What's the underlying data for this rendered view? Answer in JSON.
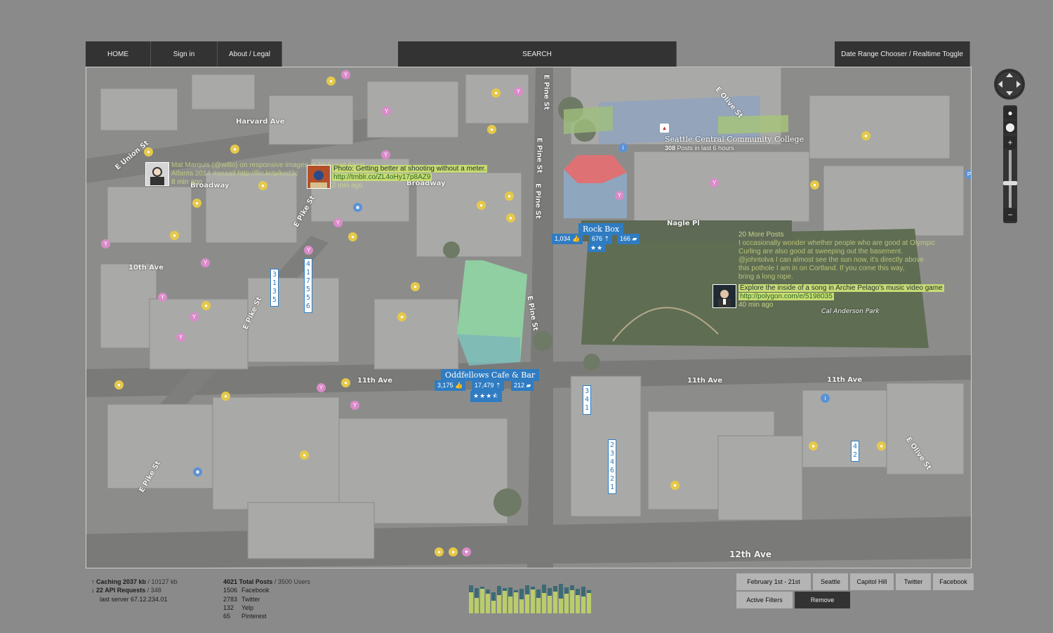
{
  "nav": {
    "home": "HOME",
    "signin": "Sign in",
    "about": "About / Legal",
    "search": "SEARCH",
    "date_toggle": "Date Range Chooser / Realtime Toggle"
  },
  "streets": {
    "harvard": "Harvard Ave",
    "union": "E Union St",
    "broadway_a": "Broadway",
    "broadway_b": "Broadway",
    "pike_a": "E Pike St",
    "pike_b": "E Pike St",
    "pike_c": "E Pike St",
    "tenth": "10th Ave",
    "eleventh_a": "11th Ave",
    "eleventh_b": "11th Ave",
    "eleventh_c": "11th Ave",
    "twelfth": "12th Ave",
    "pine_a": "E Pine St",
    "pine_b": "E Pine St",
    "pine_c": "E Pine St",
    "pine_d": "E Pine St",
    "olive_a": "E Olive St",
    "olive_b": "E Olive St",
    "nagle": "Nagle Pl",
    "park": "Cal Anderson Park"
  },
  "campus": {
    "name": "Seattle Central Community College",
    "count": "308",
    "suffix": " Posts in last 6 hours"
  },
  "venues": {
    "rockbox": {
      "name": "Rock Box",
      "likes": "1,034",
      "checkins": "676",
      "comments": "166",
      "stars": "★★"
    },
    "oddfellows": {
      "name": "Oddfellows Cafe & Bar",
      "likes": "3,175",
      "checkins": "17,479",
      "comments": "212",
      "stars": "★★★⯪"
    }
  },
  "counters": {
    "c1": "3\n1\n3\n5",
    "c2": "4\n1\n7\n5\n5\n6",
    "c3": "3\n4\n1",
    "c4": "2\n3\n4\n6\n2\n1",
    "c5": "4\n2"
  },
  "posts": {
    "matt": {
      "line1a": "Mat Marquis (",
      "line1b": "@wilto",
      "line1c": ") on responsive images at An Event Apart",
      "line2a": "Atlanta 2014 ",
      "line2b": "#aeaatl http://flic.kr/p/ked3c",
      "time": "8 min ago"
    },
    "photo": {
      "text": "Photo: Getting better at shooting without a meter.",
      "link": "http://tmblr.co/ZL4oHy17p8AZ9",
      "time": "2 min ago"
    },
    "more": {
      "label": "20 More Posts",
      "l1": "I occasionally wonder whether people who are good at Olympic",
      "l2": "Curling are also good at sweeping out the basement.",
      "l3a": "@johntolva",
      "l3b": " I can almost see the sun now, it's directly above",
      "l4": "this pothole I am in on Cortland. If you come this way,",
      "l5": "bring a long rope."
    },
    "archie": {
      "text": "Explore the inside of a song in Archie Pelago's music video game",
      "link": "http://polygon.com/e/5198035",
      "time": "40 min ago"
    }
  },
  "zoom": {
    "plus": "+",
    "minus": "−"
  },
  "stats": {
    "caching_label": "Caching 2037 kb",
    "caching_total": " / 10127 kb",
    "api_label": "22 API Requests",
    "api_total": " / 348",
    "server": "last server 67.12.234.01",
    "posts_total": "4021 Total Posts",
    "users": " / 3500 Users",
    "sources": [
      {
        "count": "1506",
        "name": "Facebook"
      },
      {
        "count": "2783",
        "name": "Twitter"
      },
      {
        "count": "132",
        "name": "Yelp"
      },
      {
        "count": "65",
        "name": "Pinterest"
      }
    ]
  },
  "histogram": {
    "yellow": [
      30,
      22,
      35,
      28,
      18,
      26,
      32,
      24,
      30,
      20,
      27,
      34,
      22,
      29,
      25,
      31,
      21,
      28,
      33,
      26,
      24,
      29
    ],
    "blue": [
      40,
      36,
      38,
      34,
      30,
      39,
      36,
      37,
      33,
      35,
      40,
      38,
      34,
      41,
      36,
      39,
      42,
      37,
      40,
      35,
      38,
      33
    ]
  },
  "filters": {
    "date": "February 1st - 21st",
    "seattle": "Seattle",
    "capitol": "Capitol Hill",
    "twitter": "Twitter",
    "facebook": "Facebook",
    "active": "Active Filters",
    "remove": "Remove"
  },
  "colors": {
    "venue": "#2f7cc2",
    "post_highlight": "#c8db74",
    "nav": "#333333"
  }
}
